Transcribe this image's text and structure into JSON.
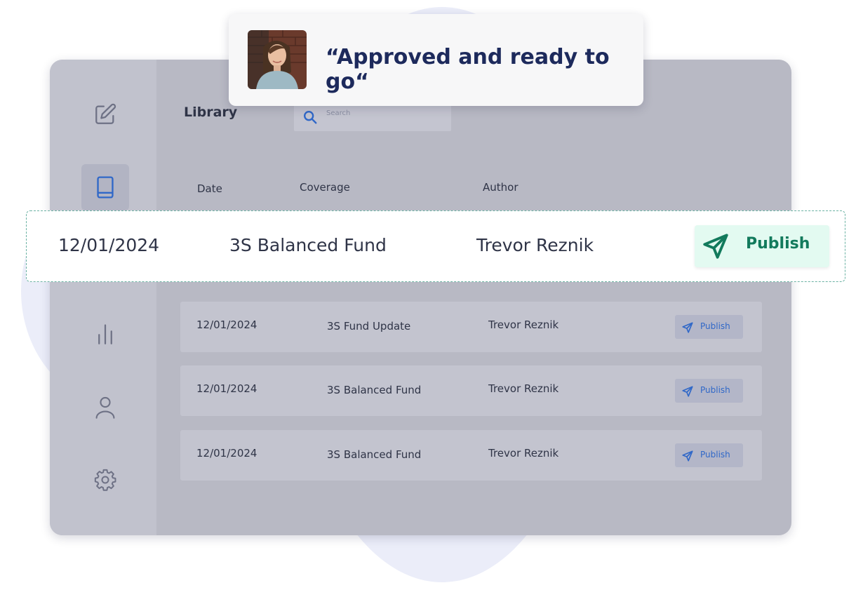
{
  "quote": {
    "text": "“Approved and ready to go“"
  },
  "sidebar": {
    "items": [
      {
        "name": "edit",
        "icon": "edit-icon",
        "active": false
      },
      {
        "name": "library",
        "icon": "book-icon",
        "active": true
      },
      {
        "name": "analytics",
        "icon": "bar-chart-icon",
        "active": false
      },
      {
        "name": "profile",
        "icon": "user-icon",
        "active": false
      },
      {
        "name": "settings",
        "icon": "gear-icon",
        "active": false
      }
    ]
  },
  "header": {
    "title": "Library"
  },
  "search": {
    "placeholder": "Search"
  },
  "table": {
    "columns": {
      "date": "Date",
      "coverage": "Coverage",
      "author": "Author"
    }
  },
  "highlight_row": {
    "date": "12/01/2024",
    "coverage": "3S Balanced Fund",
    "author": "Trevor Reznik",
    "action": "Publish"
  },
  "rows": [
    {
      "date": "12/01/2024",
      "coverage": "3S Fund Update",
      "author": "Trevor Reznik",
      "action": "Publish"
    },
    {
      "date": "12/01/2024",
      "coverage": "3S Balanced Fund",
      "author": "Trevor Reznik",
      "action": "Publish"
    },
    {
      "date": "12/01/2024",
      "coverage": "3S Balanced Fund",
      "author": "Trevor Reznik",
      "action": "Publish"
    }
  ],
  "colors": {
    "accent_blue": "#3068c8",
    "publish_green": "#127a5c",
    "publish_green_bg": "#e3faf1",
    "quote_navy": "#1d2a5c"
  }
}
